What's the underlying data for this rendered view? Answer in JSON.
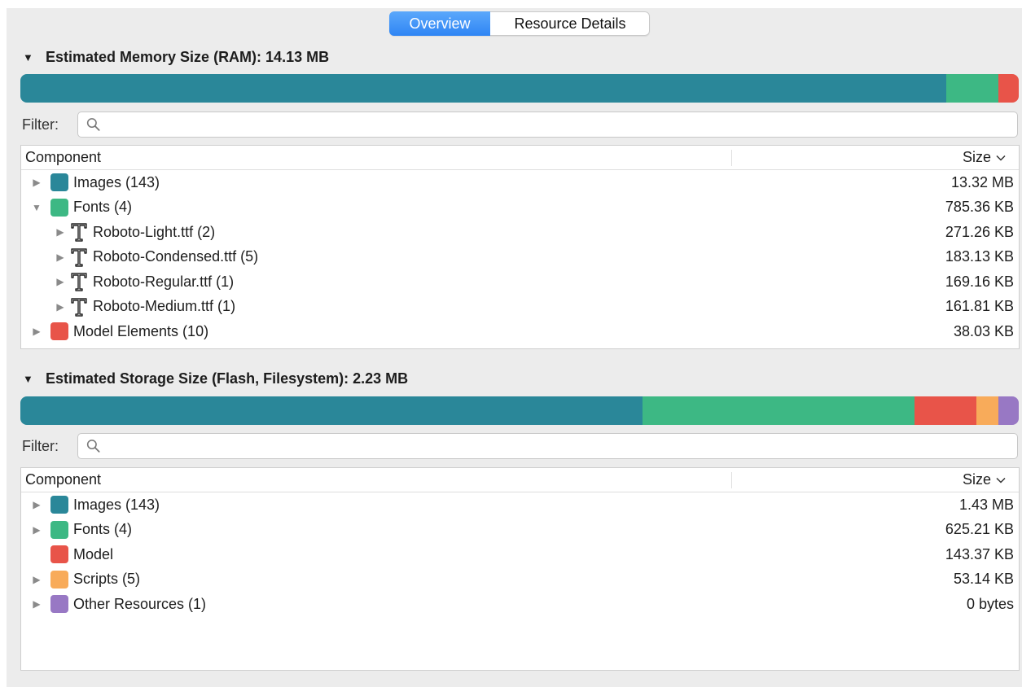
{
  "tabs": {
    "overview": "Overview",
    "resource_details": "Resource Details"
  },
  "colors": {
    "images": "#2a8799",
    "fonts": "#3db884",
    "model": "#e85449",
    "scripts": "#f8ab5a",
    "other": "#9878c4"
  },
  "memory": {
    "title": "Estimated Memory Size (RAM): 14.13 MB",
    "filter_label": "Filter:",
    "filter_value": "",
    "filter_placeholder": "",
    "col_component": "Component",
    "col_size": "Size",
    "bar": [
      {
        "name": "Images",
        "fraction": 0.927
      },
      {
        "name": "Fonts",
        "fraction": 0.053
      },
      {
        "name": "Model Elements",
        "fraction": 0.02
      }
    ],
    "rows": [
      {
        "label": "Images (143)",
        "size": "13.32 MB"
      },
      {
        "label": "Fonts (4)",
        "size": "785.36 KB"
      },
      {
        "label": "Roboto-Light.ttf (2)",
        "size": "271.26 KB"
      },
      {
        "label": "Roboto-Condensed.ttf (5)",
        "size": "183.13 KB"
      },
      {
        "label": "Roboto-Regular.ttf (1)",
        "size": "169.16 KB"
      },
      {
        "label": "Roboto-Medium.ttf (1)",
        "size": "161.81 KB"
      },
      {
        "label": "Model Elements (10)",
        "size": "38.03 KB"
      }
    ]
  },
  "storage": {
    "title": "Estimated Storage Size (Flash, Filesystem): 2.23 MB",
    "filter_label": "Filter:",
    "filter_value": "",
    "filter_placeholder": "",
    "col_component": "Component",
    "col_size": "Size",
    "bar": [
      {
        "name": "Images",
        "fraction": 0.623
      },
      {
        "name": "Fonts",
        "fraction": 0.273
      },
      {
        "name": "Model",
        "fraction": 0.062
      },
      {
        "name": "Scripts",
        "fraction": 0.022
      },
      {
        "name": "Other Resources",
        "fraction": 0.02
      }
    ],
    "rows": [
      {
        "label": "Images (143)",
        "size": "1.43 MB"
      },
      {
        "label": "Fonts (4)",
        "size": "625.21 KB"
      },
      {
        "label": "Model",
        "size": "143.37 KB"
      },
      {
        "label": "Scripts (5)",
        "size": "53.14 KB"
      },
      {
        "label": "Other Resources (1)",
        "size": "0 bytes"
      }
    ]
  }
}
